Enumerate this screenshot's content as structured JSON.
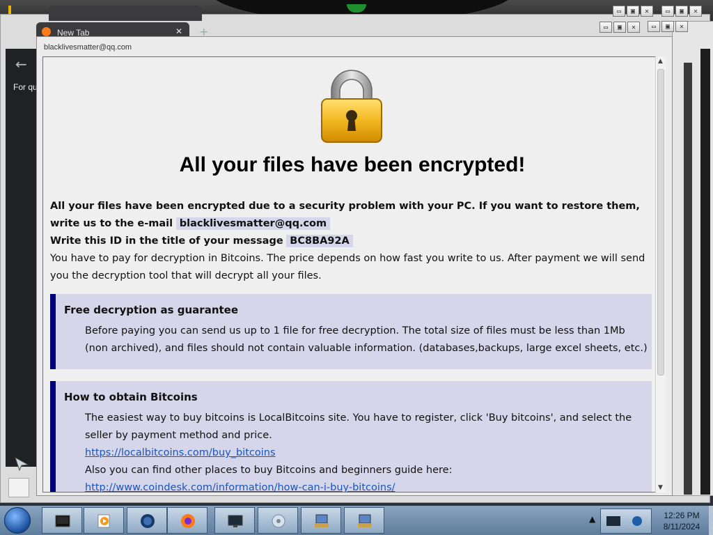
{
  "background": {
    "browser_tab_title": "New Tab",
    "browser_tab_close": "✕",
    "browser_new_tab": "+",
    "back_arrow": "←",
    "partial_text": "For qu"
  },
  "window_buttons": {
    "minimize": "▭",
    "maximize": "▣",
    "close": "✕"
  },
  "ransom_window": {
    "title": "blacklivesmatter@qq.com",
    "headline": "All your files have been encrypted!",
    "intro_bold_1": "All your files have been encrypted due to a security problem with your PC. If you want to restore them, write us to the e-mail",
    "email": "blacklivesmatter@qq.com",
    "intro_bold_2": "Write this ID in the title of your message",
    "id_code": "BC8BA92A",
    "intro_text": "You have to pay for decryption in Bitcoins. The price depends on how fast you write to us. After payment we will send you the decryption tool that will decrypt all your files.",
    "guarantee": {
      "title": "Free decryption as guarantee",
      "body": "Before paying you can send us up to 1 file for free decryption. The total size of files must be less than 1Mb (non archived), and files should not contain valuable information. (databases,backups, large excel sheets, etc.)"
    },
    "bitcoin": {
      "title": "How to obtain Bitcoins",
      "body_1": "The easiest way to buy bitcoins is LocalBitcoins site. You have to register, click 'Buy bitcoins', and select the seller by payment method and price.",
      "link_1": "https://localbitcoins.com/buy_bitcoins",
      "body_2": "Also you can find other places to buy Bitcoins and beginners guide here:",
      "link_2": "http://www.coindesk.com/information/how-can-i-buy-bitcoins/"
    },
    "scroll_up": "▲",
    "scroll_down": "▼"
  },
  "taskbar": {
    "items": [
      "media-center-icon",
      "media-player-icon",
      "globe-browser-icon",
      "firefox-icon",
      "remote-desktop-icon",
      "disc-app-icon",
      "installer-icon-1",
      "installer-icon-2"
    ],
    "tray_arrow": "▲",
    "clock_time": "12:26 PM",
    "clock_date": "8/11/2024"
  }
}
